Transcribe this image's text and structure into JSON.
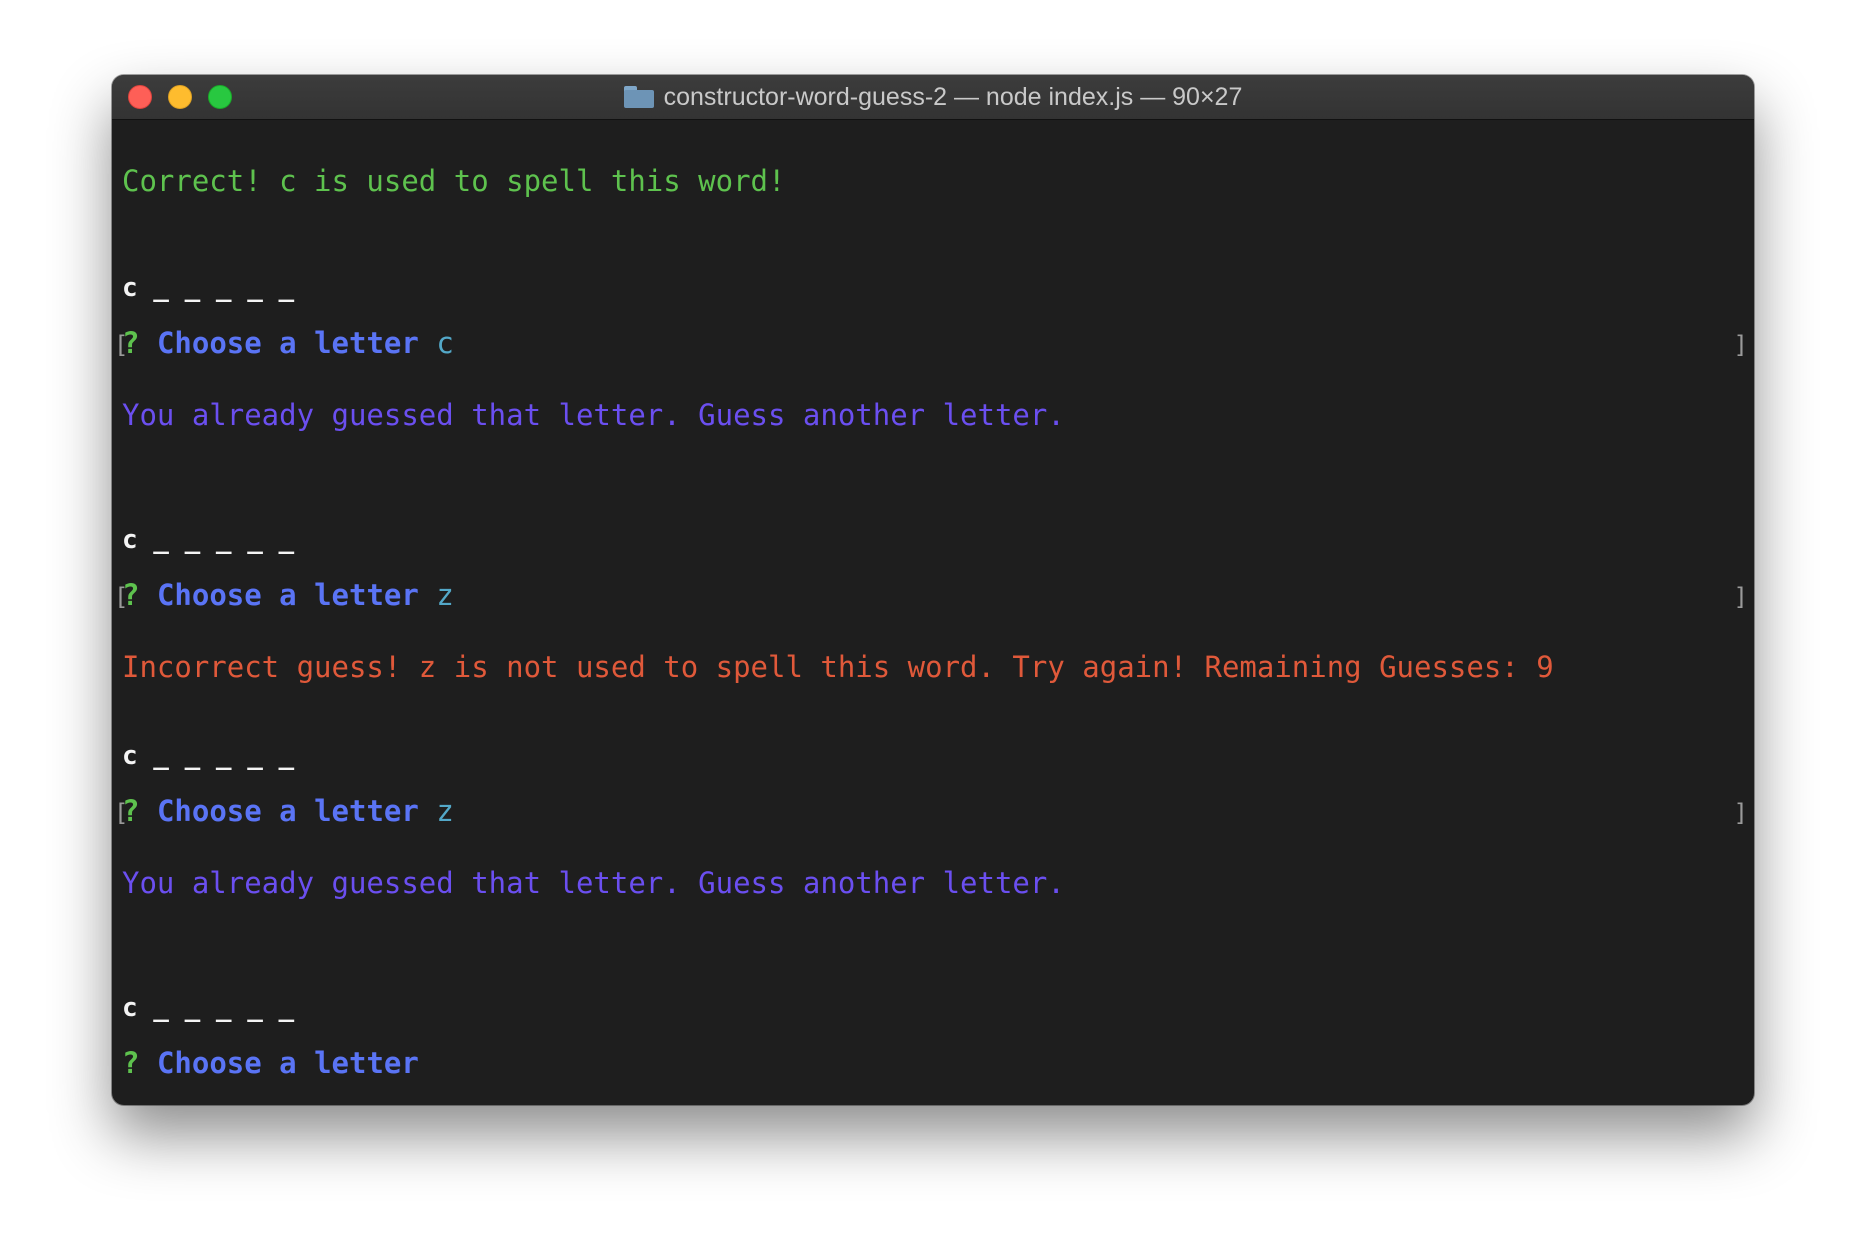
{
  "window": {
    "title": "constructor-word-guess-2 — node index.js — 90×27"
  },
  "terminal": {
    "lines": {
      "correct_msg": "Correct! c is used to spell this word!",
      "word_1": "c _ _ _ _ _",
      "prompt_1": {
        "mark": "?",
        "question": "Choose a letter",
        "answer": "c"
      },
      "already_1": "You already guessed that letter. Guess another letter.",
      "word_2": "c _ _ _ _ _",
      "prompt_2": {
        "mark": "?",
        "question": "Choose a letter",
        "answer": "z"
      },
      "incorrect_msg": "Incorrect guess! z is not used to spell this word. Try again! Remaining Guesses: 9",
      "word_3": "c _ _ _ _ _",
      "prompt_3": {
        "mark": "?",
        "question": "Choose a letter",
        "answer": "z"
      },
      "already_2": "You already guessed that letter. Guess another letter.",
      "word_4": "c _ _ _ _ _",
      "prompt_4": {
        "mark": "?",
        "question": "Choose a letter",
        "answer": ""
      }
    },
    "brackets": {
      "left": "[",
      "right": "]"
    }
  },
  "colors": {
    "success": "#5ec24e",
    "warning": "#6b4ff0",
    "error": "#e0593a",
    "prompt": "#5a74f5",
    "answer": "#53a8c8"
  }
}
